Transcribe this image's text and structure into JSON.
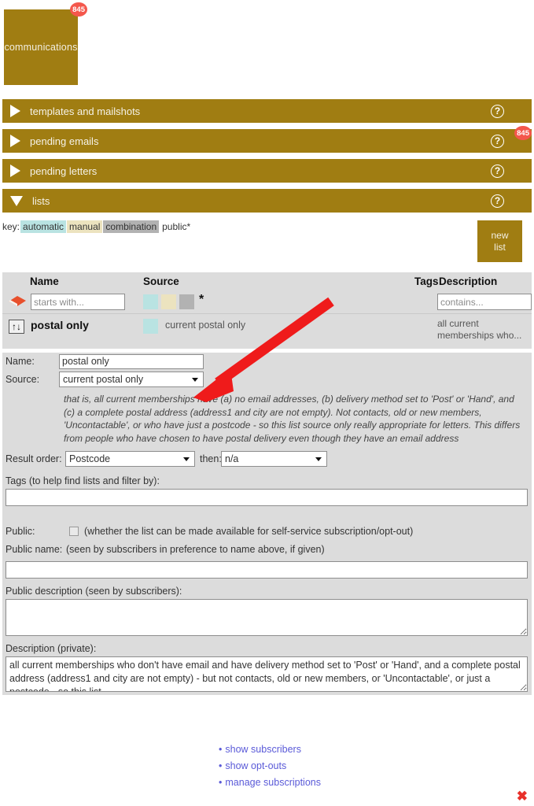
{
  "module": {
    "tile_label": "communications",
    "badge_count": "845",
    "badge_color": "#f4574c",
    "accent_color": "#a07d12"
  },
  "sections": [
    {
      "label": "templates and mailshots",
      "state": "collapsed",
      "arrow": "triangle-right",
      "help": "?",
      "badge": null
    },
    {
      "label": "pending emails",
      "state": "collapsed",
      "arrow": "triangle-right",
      "help": "?",
      "badge": "845"
    },
    {
      "label": "pending letters",
      "state": "collapsed",
      "arrow": "triangle-right",
      "help": "?",
      "badge": null
    },
    {
      "label": "lists",
      "state": "expanded",
      "arrow": "triangle-down",
      "help": "?",
      "badge": null
    }
  ],
  "key": {
    "prefix": "key:",
    "items": [
      {
        "label": "automatic",
        "color": "#b9e3e2"
      },
      {
        "label": "manual",
        "color": "#ece3bf"
      },
      {
        "label": "combination",
        "color": "#b2b2b2"
      },
      {
        "label": "public*",
        "color": "transparent"
      }
    ]
  },
  "new_list_button": {
    "line1": "new",
    "line2": "list"
  },
  "table": {
    "headers": {
      "name": "Name",
      "source": "Source",
      "tags": "Tags",
      "description": "Description"
    },
    "filter": {
      "eraser_title": "clear filters",
      "name_placeholder": "starts with...",
      "name_value": "",
      "description_placeholder": "contains...",
      "description_value": "",
      "source_star": "*",
      "source_swatches": [
        "#b9e3e2",
        "#ece3bf",
        "#b2b2b2"
      ]
    },
    "rows": [
      {
        "sort_glyph": "↑↓",
        "name": "postal only",
        "source_swatch": "#b9e3e2",
        "source": "current postal only",
        "tags": "",
        "description": "all current memberships who..."
      }
    ]
  },
  "detail": {
    "name_label": "Name:",
    "name_value": "postal only",
    "source_label": "Source:",
    "source_value": "current postal only",
    "source_note": "that is, all current memberships have (a) no email addresses, (b) delivery method set to 'Post' or 'Hand', and (c) a complete postal address (address1 and city are not empty). Not contacts, old or new members, 'Uncontactable', or who have just a postcode - so this list source only really appropriate for letters. This differs from people who have chosen to have postal delivery even though they have an email address",
    "result_order_label": "Result order:",
    "result_order_value": "Postcode",
    "then_label": "then:",
    "then_value": "n/a",
    "tags_label": "Tags (to help find lists and filter by):",
    "tags_value": "",
    "public_label": "Public:",
    "public_checked": false,
    "public_hint": "(whether the list can be made available for self-service subscription/opt-out)",
    "public_name_label": "Public name:",
    "public_name_hint": "(seen by subscribers in preference to name above, if given)",
    "public_name_value": "",
    "public_description_label": "Public description (seen by subscribers):",
    "public_description_value": "",
    "private_description_label": "Description (private):",
    "private_description_value": "all current memberships who don't have email and have delivery method set to 'Post' or 'Hand', and a complete postal address (address1 and city are not empty) - but not contacts, old or new members, or 'Uncontactable', or just a postcode - so this list"
  },
  "links": [
    {
      "label": "show subscribers"
    },
    {
      "label": "show opt-outs"
    },
    {
      "label": "manage subscriptions"
    }
  ],
  "close_glyph": "✖",
  "annotation": {
    "arrow_color": "#ef1b1b"
  }
}
